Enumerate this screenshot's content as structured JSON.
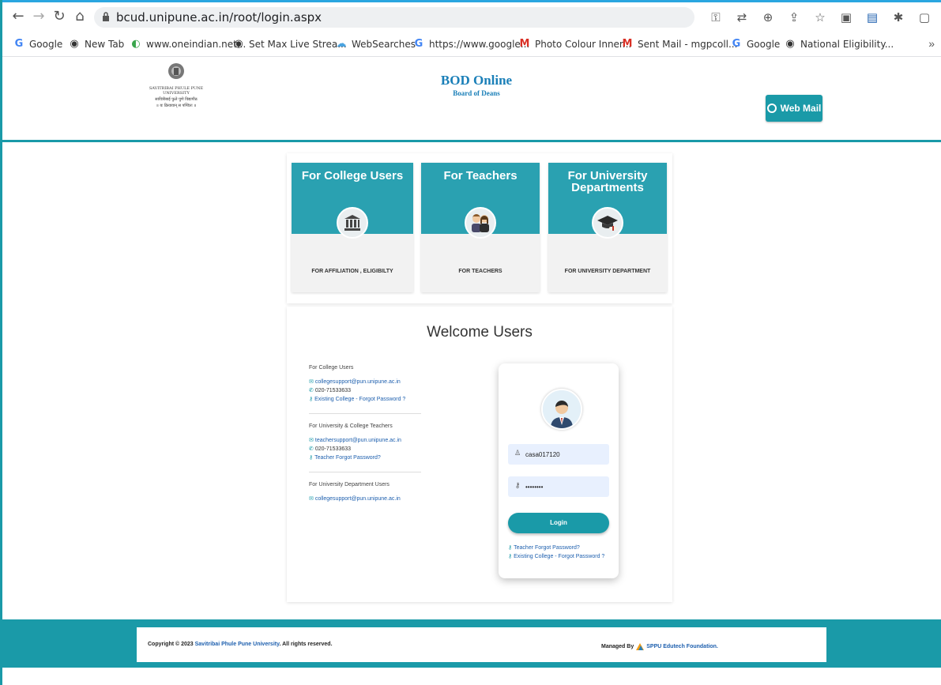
{
  "browser": {
    "url": "bcud.unipune.ac.in/root/login.aspx",
    "bookmarks": [
      {
        "label": "Google",
        "icon": "google-icon"
      },
      {
        "label": "New Tab",
        "icon": "globe-icon"
      },
      {
        "label": "www.oneindian.net...",
        "icon": "oneindian-icon"
      },
      {
        "label": "Set Max Live Strea...",
        "icon": "globe-icon"
      },
      {
        "label": "WebSearches",
        "icon": "websearches-icon"
      },
      {
        "label": "https://www.google...",
        "icon": "google-icon"
      },
      {
        "label": "Photo Colour Inner...",
        "icon": "gmail-icon"
      },
      {
        "label": "Sent Mail - mgpcoll...",
        "icon": "gmail-icon"
      },
      {
        "label": "Google",
        "icon": "google-icon"
      },
      {
        "label": "National Eligibility...",
        "icon": "globe-icon"
      }
    ],
    "more_label": "»"
  },
  "header": {
    "university_lines": [
      "SAVITRIBAI PHULE PUNE UNIVERSITY",
      "सावित्रीबाई फुले पुणे विद्यापीठ",
      "॥ यः क्रियावान् स पण्डितः ॥"
    ],
    "title": "BOD Online",
    "subtitle": "Board of Deans",
    "webmail_label": "Web Mail"
  },
  "cards": [
    {
      "title": "For College Users",
      "subtitle": "FOR AFFILIATION , ELIGIBILTY",
      "icon": "institution-icon"
    },
    {
      "title": "For Teachers",
      "subtitle": "FOR TEACHERS",
      "icon": "teachers-icon"
    },
    {
      "title": "For University Departments",
      "subtitle": "FOR UNIVERSITY DEPARTMENT",
      "icon": "graduation-cap-icon"
    }
  ],
  "welcome": {
    "title": "Welcome Users",
    "groups": [
      {
        "heading": "For College Users",
        "email": "collegesupport@pun.unipune.ac.in",
        "phone": "020-71533633",
        "link": "Existing College - Forgot Password ?"
      },
      {
        "heading": "For University & College Teachers",
        "email": "teachersupport@pun.unipune.ac.in",
        "phone": "020-71533633",
        "link": "Teacher Forgot Password?"
      },
      {
        "heading": "For University Department Users",
        "email": "collegesupport@pun.unipune.ac.in"
      }
    ]
  },
  "login": {
    "username": "casa017120",
    "password": "••••••••",
    "button_label": "Login",
    "link_teacher": "Teacher Forgot Password?",
    "link_college": "Existing College - Forgot Password ?"
  },
  "footer": {
    "copyright_prefix": "Copyright © 2023",
    "university": "Savitribai Phule Pune University",
    "rights": ". All rights reserved.",
    "managed_prefix": "Managed By",
    "managed_org": "SPPU Edutech Foundation."
  },
  "colors": {
    "teal": "#1a9aa8",
    "link": "#1d5fae",
    "card_top": "#2aa1b1"
  }
}
